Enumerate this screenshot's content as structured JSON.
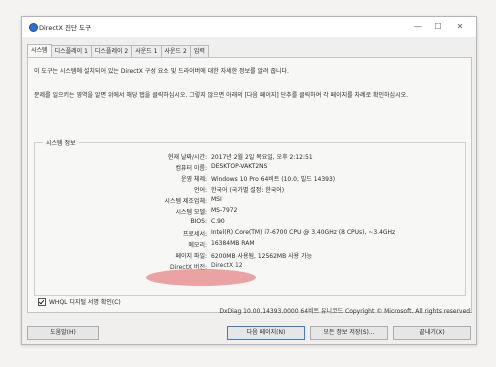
{
  "window": {
    "title": "DirectX 진단 도구",
    "controls": {
      "minimize": "—",
      "maximize": "☐",
      "close": "✕"
    }
  },
  "tabs": [
    {
      "label": "시스템"
    },
    {
      "label": "디스플레이 1"
    },
    {
      "label": "디스플레이 2"
    },
    {
      "label": "사운드 1"
    },
    {
      "label": "사운드 2"
    },
    {
      "label": "입력"
    }
  ],
  "intro": {
    "line1": "이 도구는 시스템에 설치되어 있는 DirectX 구성 요소 및 드라이버에 대한 자세한 정보를 알려 줍니다.",
    "line2": "문제를 일으키는 영역을 알면 위에서 해당 탭을 클릭하십시오. 그렇지 않으면 아래의 [다음 페이지] 단추를 클릭하여 각 페이지를 차례로 확인하십시오."
  },
  "system_info": {
    "legend": "시스템 정보",
    "rows": [
      {
        "label": "현재 날짜/시간:",
        "value": "2017년 2월 2일 목요일, 오후 2:12:51"
      },
      {
        "label": "컴퓨터 이름:",
        "value": "DESKTOP-VAKT2NS"
      },
      {
        "label": "운영 체제:",
        "value": "Windows 10 Pro 64비트 (10.0, 빌드 14393)"
      },
      {
        "label": "언어:",
        "value": "한국어 (국가별 설정: 한국어)"
      },
      {
        "label": "시스템 제조업체:",
        "value": "MSI"
      },
      {
        "label": "시스템 모델:",
        "value": "MS-7972"
      },
      {
        "label": "BIOS:",
        "value": "C.90"
      },
      {
        "label": "프로세서:",
        "value": "Intel(R) Core(TM) i7-6700 CPU @ 3.40GHz (8 CPUs), ~3.4GHz"
      },
      {
        "label": "메모리:",
        "value": "16384MB RAM"
      },
      {
        "label": "페이지 파일:",
        "value": "6200MB 사용됨, 12562MB 사용 가능"
      },
      {
        "label": "DirectX 버전:",
        "value": "DirectX 12"
      }
    ]
  },
  "whql": {
    "label": "WHQL 디지털 서명 확인(C)",
    "checked": true
  },
  "footer": "DxDiag 10.00.14393.0000 64비트 유니코드  Copyright © Microsoft. All rights reserved.",
  "buttons": {
    "help": "도움말(H)",
    "next_page": "다음 페이지(N)",
    "save_all": "모든 정보 저장(S)...",
    "exit": "끝내기(X)"
  }
}
